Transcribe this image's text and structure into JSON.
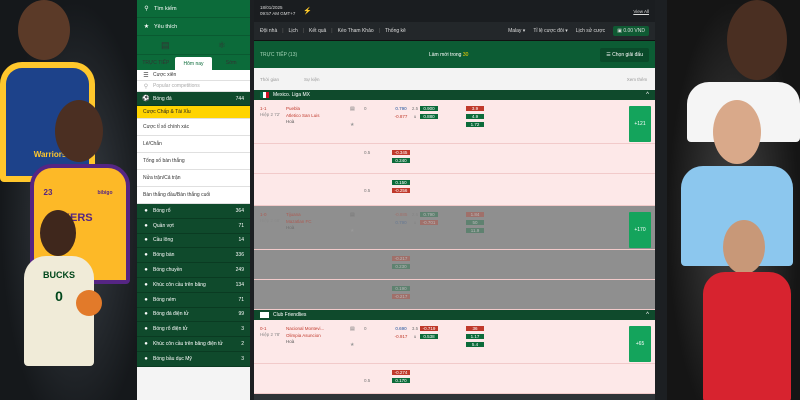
{
  "nav": {
    "search_label": "Tìm kiếm",
    "favorites_label": "Yêu thích",
    "tabs": [
      "TRỰC TIẾP",
      "Hôm nay",
      "Sớm"
    ],
    "parlay_label": "Cược xiên",
    "search_placeholder": "Popular competitions",
    "football_header": {
      "label": "Bóng đá",
      "count": "744"
    },
    "subitems": [
      "Cược Chấp & Tài Xỉu",
      "Cược tỉ số chính xác",
      "Lẻ/Chẵn",
      "Tổng số bàn thắng",
      "Nửa trận/Cả trận",
      "Bàn thắng đầu/Bàn thắng cuối"
    ],
    "sports": [
      {
        "label": "Bóng rổ",
        "count": "364"
      },
      {
        "label": "Quần vợt",
        "count": "71"
      },
      {
        "label": "Cầu lông",
        "count": "14"
      },
      {
        "label": "Bóng bàn",
        "count": "336"
      },
      {
        "label": "Bóng chuyền",
        "count": "249"
      },
      {
        "label": "Khúc côn cầu trên băng",
        "count": "134"
      },
      {
        "label": "Bóng ném",
        "count": "71"
      },
      {
        "label": "Bóng đá điện tử",
        "count": "99"
      },
      {
        "label": "Bóng rổ điện tử",
        "count": "3"
      },
      {
        "label": "Khúc côn cầu trên băng điện tử",
        "count": "2"
      },
      {
        "label": "Bóng bầu dục Mỹ",
        "count": "3"
      }
    ]
  },
  "main": {
    "date": "18/01/2025",
    "clock": "09:57 AM GMT+7",
    "view_all": "View All",
    "menu": [
      "Đội nhà",
      "Lịch",
      "Kết quả",
      "Kèo Tham Khảo",
      "Thống kê"
    ],
    "odds_format": "Malay",
    "bet_level": "Tỉ lệ cược đôi",
    "bet_history": "Lịch sử cược",
    "wallet": "0.00 VND",
    "live_label": "TRỰC TIẾP (13)",
    "refresh_label": "Làm mới trong",
    "refresh_seconds": "30",
    "pick_league": "Chọn giải đấu",
    "col_time": "Thời gian",
    "col_event": "Sự kiện",
    "col_more": "Xem thêm",
    "leagues": [
      {
        "name": "Mexico. Liga MX",
        "collapse": "^"
      },
      {
        "name": "Club Friendlies",
        "collapse": "^"
      }
    ],
    "matches": [
      {
        "score": "1-1",
        "phase": "Hiệp 2 72'",
        "team1": "Puebla",
        "team2": "Atletico San Luis",
        "draw": "Hoà",
        "lines": [
          {
            "h": "0",
            "a": "0.790",
            "m": "2.5",
            "b": "0.900",
            "x": "3.9"
          },
          {
            "h": "",
            "a": "-0.877",
            "m": "u",
            "b": "0.880",
            "x": "4.9"
          },
          {
            "h": "",
            "a": "",
            "m": "",
            "b": "",
            "x": "1.72"
          }
        ],
        "more": "+121"
      },
      {
        "lines": [
          {
            "h": "0.5",
            "a": "-0.345",
            "m": "",
            "b": "",
            "x": ""
          },
          {
            "h": "",
            "a": "0.240",
            "m": "",
            "b": "",
            "x": ""
          }
        ]
      },
      {
        "lines": [
          {
            "h": "",
            "a": "0.150",
            "m": "",
            "b": "",
            "x": ""
          },
          {
            "h": "0.5",
            "a": "-0.256",
            "m": "",
            "b": "",
            "x": ""
          }
        ]
      },
      {
        "score": "1-0",
        "phase": "Hiệp 2 68'",
        "team1": "Tijuana",
        "team2": "Mazatlan FC",
        "draw": "Hoà",
        "lines": [
          {
            "h": "",
            "a": "-0.885",
            "m": "2.5",
            "b": "0.790",
            "x": "1.84"
          },
          {
            "h": "",
            "a": "0.790",
            "m": "u",
            "b": "-0.701",
            "x": "50"
          },
          {
            "h": "",
            "a": "",
            "m": "",
            "b": "",
            "x": "11.9"
          }
        ],
        "more": "+170",
        "dim": true
      },
      {
        "lines": [
          {
            "h": "",
            "a": "-0.217",
            "m": "",
            "b": "",
            "x": ""
          },
          {
            "h": "",
            "a": "0.230",
            "m": "",
            "b": "",
            "x": ""
          }
        ],
        "dim": true
      },
      {
        "lines": [
          {
            "h": "",
            "a": "0.190",
            "m": "",
            "b": "",
            "x": ""
          },
          {
            "h": "",
            "a": "-0.217",
            "m": "",
            "b": "",
            "x": ""
          }
        ],
        "dim": true
      },
      {
        "score": "0-1",
        "phase": "Hiệp 2 78'",
        "team1": "Nacional Montevi...",
        "team2": "Olimpia Asuncion",
        "draw": "Hoà",
        "lines": [
          {
            "h": "0",
            "a": "0.690",
            "m": "3.5",
            "b": "-0.719",
            "x": "36"
          },
          {
            "h": "",
            "a": "-0.917",
            "m": "u",
            "b": "0.538",
            "x": "1.17"
          },
          {
            "h": "",
            "a": "",
            "m": "",
            "b": "",
            "x": "5.4"
          }
        ],
        "more": "+65"
      },
      {
        "lines": [
          {
            "h": "",
            "a": "-0.274",
            "m": "",
            "b": "",
            "x": ""
          },
          {
            "h": "0.5",
            "a": "0.170",
            "m": "",
            "b": "",
            "x": ""
          }
        ]
      }
    ]
  },
  "players": {
    "left_top_shirt": "Warriors",
    "left_mid_shirt": "LAKERS",
    "left_bottom_shirt": "BUCKS",
    "left_bottom_number": "0",
    "left_mid_number": "23",
    "left_sponsor": "bibigo"
  },
  "colors": {
    "brand_green": "#0c6b3a",
    "highlight_yellow": "#ffd400",
    "more_button": "#14a45c"
  }
}
